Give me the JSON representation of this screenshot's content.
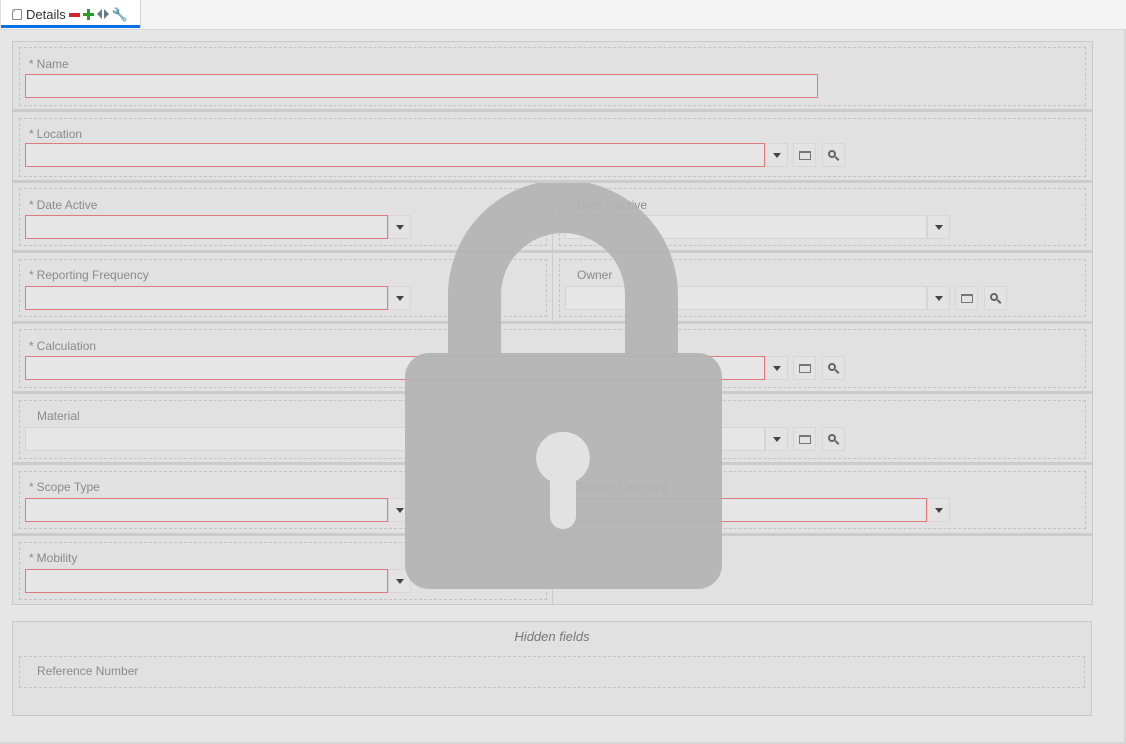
{
  "tab": {
    "label": "Details",
    "icons": [
      "document-icon",
      "remove-icon",
      "add-icon",
      "previous-icon",
      "next-icon",
      "wrench-icon"
    ]
  },
  "colors": {
    "tab_accent": "#0a6fe0",
    "required_border": "#e07a7a",
    "remove": "#d8232a",
    "add": "#2a9c2a",
    "lock_overlay": "#b3b3b3"
  },
  "fields": {
    "name": {
      "label": "Name",
      "required": "*",
      "value": ""
    },
    "location": {
      "label": "Location",
      "required": "*",
      "value": ""
    },
    "date_active": {
      "label": "Date Active",
      "required": "*",
      "value": ""
    },
    "date_inactive": {
      "label": "Date Inactive",
      "value": ""
    },
    "reporting_frequency": {
      "label": "Reporting Frequency",
      "required": "*",
      "value": ""
    },
    "owner": {
      "label": "Owner",
      "value": ""
    },
    "calculation": {
      "label": "Calculation",
      "required": "*",
      "value": ""
    },
    "material": {
      "label": "Material",
      "value": ""
    },
    "scope_type": {
      "label": "Scope Type",
      "required": "*",
      "value": ""
    },
    "source_category": {
      "label": "Source Category",
      "required": "*",
      "value": ""
    },
    "mobility": {
      "label": "Mobility",
      "required": "*",
      "value": ""
    }
  },
  "hidden": {
    "title": "Hidden fields",
    "reference_number": {
      "label": "Reference Number"
    }
  },
  "overlay": {
    "icon": "lock-icon",
    "state": "locked"
  }
}
